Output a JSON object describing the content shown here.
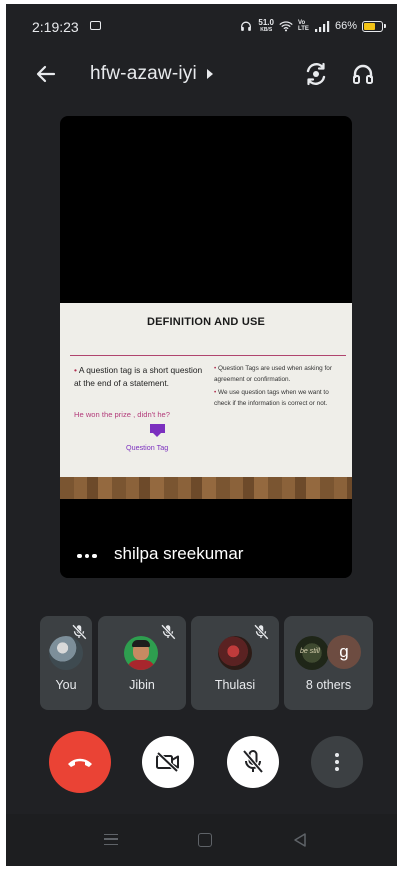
{
  "status_bar": {
    "time": "2:19:23",
    "speed_value": "51.0",
    "speed_unit": "KB/S",
    "network": "Vo LTE",
    "battery": "66%",
    "battery_fraction": 0.66
  },
  "header": {
    "meeting_code": "hfw-azaw-iyi",
    "icons": [
      "back-arrow-icon",
      "switch-camera-icon",
      "headphones-icon"
    ]
  },
  "stage": {
    "presenter_name": "shilpa sreekumar",
    "slide": {
      "title": "DEFINITION AND USE",
      "bullet_mark": "•",
      "left_text": "A question tag is a short question at the end of a statement.",
      "example": "He won the prize , didn't he?",
      "tag_label": "Question Tag",
      "right_bullets": [
        "Question Tags are used when asking for agreement or confirmation.",
        "We use question tags when we want to check if the information is correct or not."
      ]
    }
  },
  "participants": [
    {
      "name": "You",
      "muted": true
    },
    {
      "name": "Jibin",
      "muted": true
    },
    {
      "name": "Thulasi",
      "muted": true
    },
    {
      "name": "8 others",
      "badge": "g",
      "avatar_text": "be still"
    }
  ],
  "controls": {
    "end_call_color": "#ea4335",
    "icons": [
      "end-call-icon",
      "camera-off-icon",
      "mic-off-icon",
      "more-vert-icon"
    ]
  },
  "colors": {
    "background": "#202124",
    "tile": "#3c4043",
    "accent_red": "#ea4335",
    "slide_accent": "#b0446e",
    "tag_purple": "#7b2fbf"
  }
}
